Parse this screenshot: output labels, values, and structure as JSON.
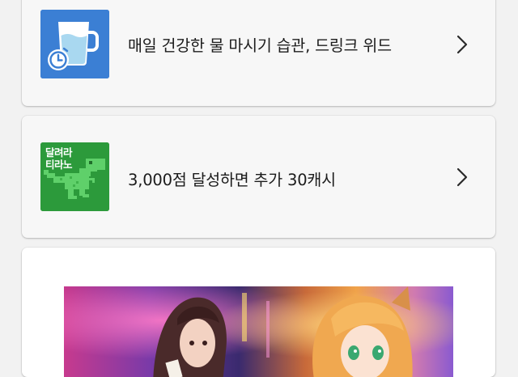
{
  "offers": [
    {
      "title": "매일 건강한 물 마시기 습관, 드링크 위드",
      "thumbnail_icon": "water-cup-alarm-icon",
      "thumbnail_color": "#3b7fd4"
    },
    {
      "title": "3,000점 달성하면 추가 30캐시",
      "thumbnail_icon": "pixel-dinosaur-icon",
      "thumbnail_color": "#2c9a3b",
      "thumbnail_text_line1": "달려라",
      "thumbnail_text_line2": "티라노"
    }
  ],
  "chevron_icon": "chevron-right-icon",
  "banner": {
    "image": "anime-game-banner"
  }
}
